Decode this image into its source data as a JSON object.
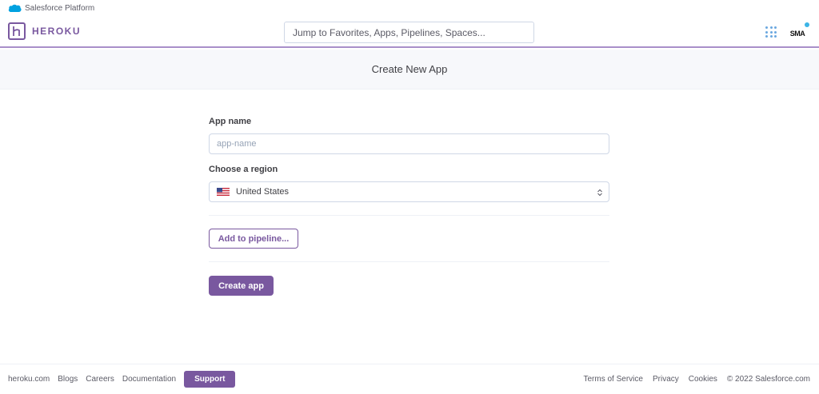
{
  "platform_bar": {
    "label": "Salesforce Platform",
    "icon": "salesforce-cloud-icon"
  },
  "header": {
    "logo_text": "HEROKU",
    "logo_icon": "heroku-logo-icon",
    "search_placeholder": "Jump to Favorites, Apps, Pipelines, Spaces...",
    "apps_icon": "apps-grid-icon",
    "avatar_text": "SMA"
  },
  "page": {
    "title": "Create New App"
  },
  "form": {
    "app_name_label": "App name",
    "app_name_placeholder": "app-name",
    "app_name_value": "",
    "region_label": "Choose a region",
    "region_value": "United States",
    "region_flag_icon": "us-flag-icon",
    "add_pipeline_label": "Add to pipeline...",
    "create_app_label": "Create app"
  },
  "footer": {
    "left_links": [
      "heroku.com",
      "Blogs",
      "Careers",
      "Documentation"
    ],
    "support_label": "Support",
    "right_links": [
      "Terms of Service",
      "Privacy",
      "Cookies"
    ],
    "copyright": "© 2022 Salesforce.com"
  },
  "colors": {
    "brand_purple": "#79589f",
    "accent_blue": "#6ba8e0",
    "subheader_bg": "#f7f8fb",
    "border": "#cfd7e6"
  }
}
